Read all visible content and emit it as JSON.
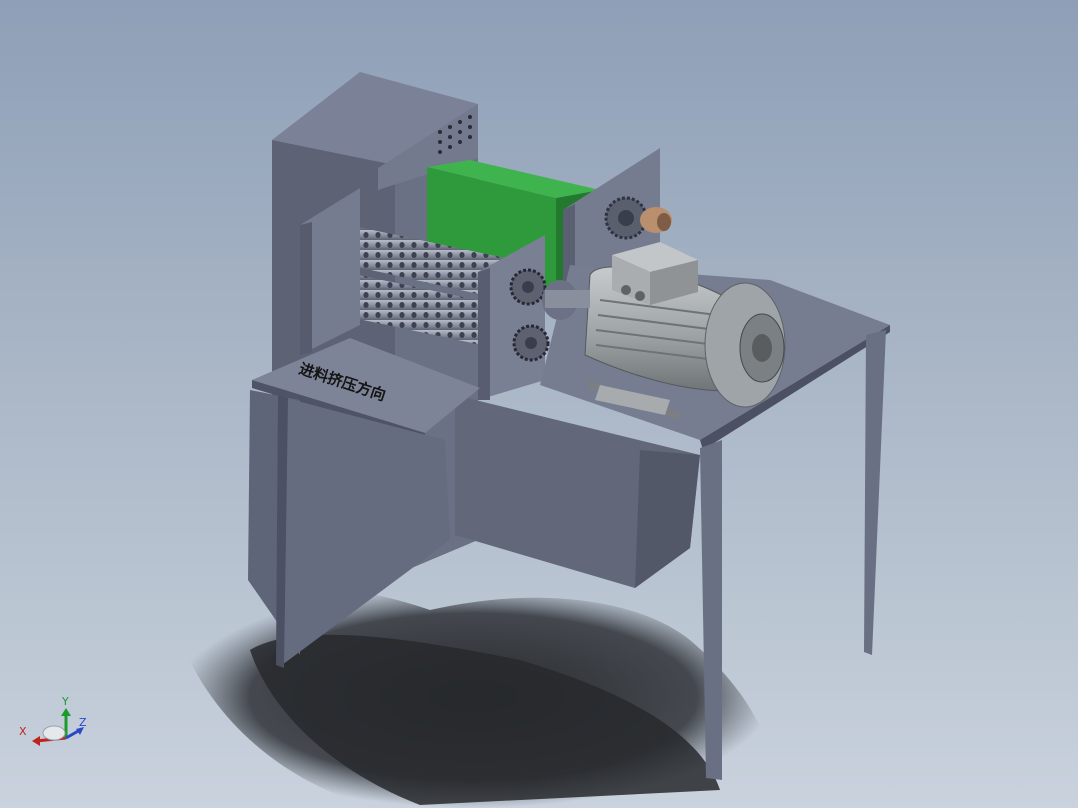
{
  "viewport": {
    "background_top": "#8e9fb7",
    "background_bottom": "#c9d2dd"
  },
  "model": {
    "feed_direction_label": "进料挤压方向",
    "colors": {
      "frame": "#6c7287",
      "frame_light": "#8a90a3",
      "frame_dark": "#4d5264",
      "green_block": "#2f9a3c",
      "motor": "#9aa0a4",
      "coupling": "#b98f6e",
      "shadow": "#2d2f33"
    },
    "icons": [
      "roller-icon",
      "gear-icon",
      "motor-icon",
      "fan-cover-icon",
      "terminal-box-icon"
    ]
  },
  "triad": {
    "x_label": "X",
    "y_label": "Y",
    "z_label": "Z",
    "x_color": "#c0231f",
    "y_color": "#1c9a2b",
    "z_color": "#2a47c8"
  }
}
